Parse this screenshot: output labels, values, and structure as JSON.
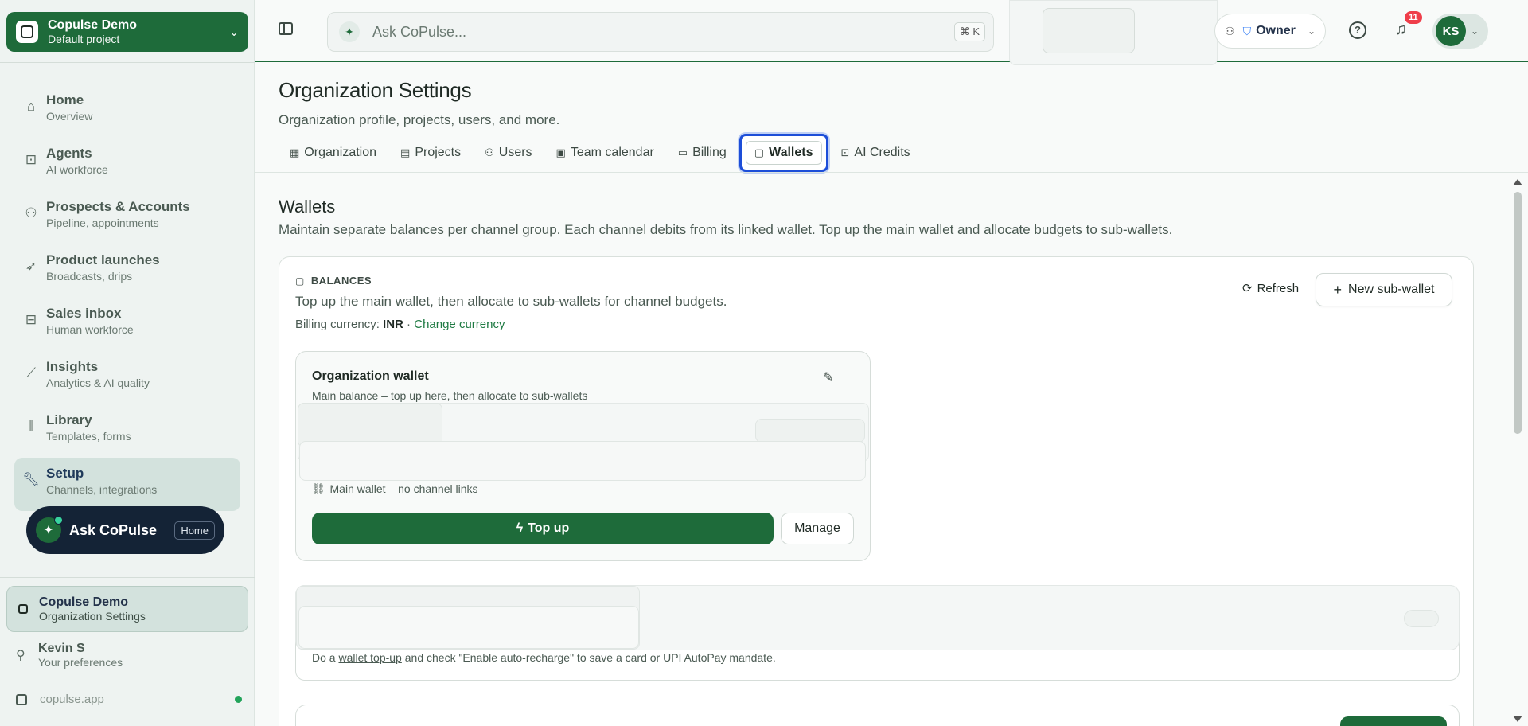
{
  "sidebar": {
    "org_switcher": {
      "name": "Copulse Demo",
      "sub": "Default project"
    },
    "items": [
      {
        "title": "Home",
        "sub": "Overview",
        "icon": "home-icon"
      },
      {
        "title": "Agents",
        "sub": "AI workforce",
        "icon": "robot-icon"
      },
      {
        "title": "Prospects & Accounts",
        "sub": "Pipeline, appointments",
        "icon": "users-icon"
      },
      {
        "title": "Product launches",
        "sub": "Broadcasts, drips",
        "icon": "rocket-icon"
      },
      {
        "title": "Sales inbox",
        "sub": "Human workforce",
        "icon": "inbox-icon"
      },
      {
        "title": "Insights",
        "sub": "Analytics & AI quality",
        "icon": "chart-icon"
      },
      {
        "title": "Library",
        "sub": "Templates, forms",
        "icon": "library-icon"
      },
      {
        "title": "Setup",
        "sub": "Channels, integrations",
        "icon": "wrench-icon"
      }
    ],
    "ask": {
      "label": "Ask CoPulse",
      "kbd": "Home"
    },
    "current_org": {
      "name": "Copulse Demo",
      "sub": "Organization Settings"
    },
    "user": {
      "name": "Kevin S",
      "sub": "Your preferences"
    },
    "app_domain": "copulse.app"
  },
  "topbar": {
    "search_placeholder": "Ask CoPulse...",
    "search_kbd": "⌘ K",
    "role": "Owner",
    "notifications": "11",
    "avatar": "KS"
  },
  "page": {
    "title": "Organization Settings",
    "subtitle": "Organization profile, projects, users, and more.",
    "tabs": [
      {
        "label": "Organization",
        "icon": "building-icon"
      },
      {
        "label": "Projects",
        "icon": "projects-icon"
      },
      {
        "label": "Users",
        "icon": "users-icon"
      },
      {
        "label": "Team calendar",
        "icon": "calendar-icon"
      },
      {
        "label": "Billing",
        "icon": "card-icon"
      },
      {
        "label": "Wallets",
        "icon": "wallet-icon"
      },
      {
        "label": "AI Credits",
        "icon": "robot-icon"
      }
    ],
    "active_tab": "Wallets"
  },
  "wallets": {
    "title": "Wallets",
    "subtitle": "Maintain separate balances per channel group. Each channel debits from its linked wallet. Top up the main wallet and allocate budgets to sub-wallets.",
    "balances_label": "BALANCES",
    "balances_sub": "Top up the main wallet, then allocate to sub-wallets for channel budgets.",
    "currency_prefix": "Billing currency: ",
    "currency": "INR",
    "currency_sep": " · ",
    "change_currency": "Change currency",
    "refresh": "Refresh",
    "new_sub_wallet": "New sub-wallet",
    "org_wallet": {
      "title": "Organization wallet",
      "sub": "Main balance – top up here, then allocate to sub-wallets",
      "link_note": "Main wallet – no channel links",
      "top_up": "Top up",
      "manage": "Manage"
    },
    "auto_recharge": {
      "prefix": "Do a ",
      "link": "wallet top-up",
      "suffix": " and check \"Enable auto-recharge\" to save a card or UPI AutoPay mandate."
    }
  }
}
